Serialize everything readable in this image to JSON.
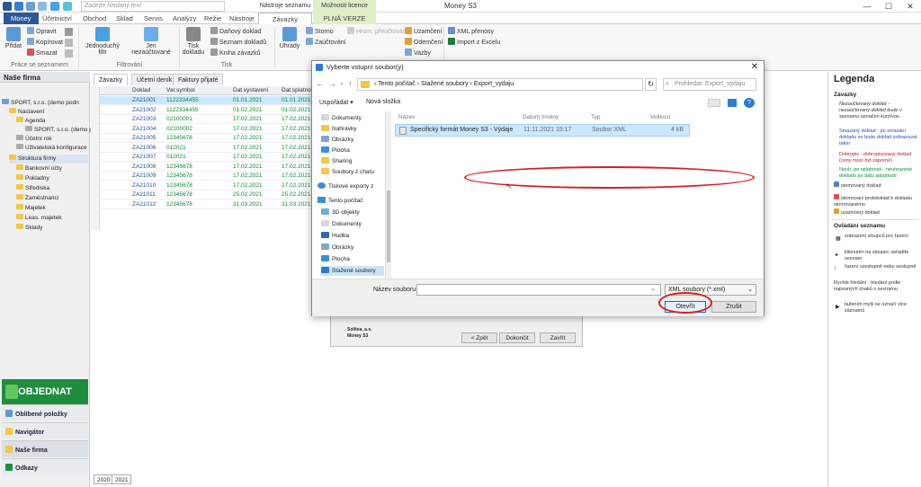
{
  "titlebar": {
    "search_placeholder": "Zadejte hledaný text",
    "context_tools": "Nástroje seznamu",
    "context_license": "Možnosti licence",
    "app_title": "Money S3",
    "min": "—",
    "max": "☐",
    "close": "✕"
  },
  "menubar": {
    "tabs": [
      "Money",
      "Účetnictví",
      "Obchod",
      "Sklad",
      "Servis",
      "Analýzy",
      "Režie",
      "Nástroje",
      "Závazky",
      "PLNÁ VERZE"
    ]
  },
  "ribbon": {
    "pridat": "Přidat",
    "opravit": "Opravit",
    "kopirovat": "Kopírovat",
    "smazat": "Smazat",
    "group_prace": "Práce se seznamem",
    "filtr": "Jednoduchý filtr",
    "jen_nezauct": "Jen nezaúčtované",
    "group_filtrovani": "Filtrování",
    "tisk_dokladu": "Tisk dokladu",
    "danovy_doklad": "Daňový doklad",
    "seznam_dokladu": "Seznam dokladů",
    "kniha_zavazku": "Kniha závazků",
    "group_tisk": "Tisk",
    "uhrady": "Úhrady",
    "storno": "Storno",
    "zauctovani": "Zaúčtování",
    "hrom_preuctovani": "Hrom. přeúčtování",
    "uzamceni": "Uzamčení",
    "odemceni": "Odemčení",
    "vazby": "Vazby",
    "xml_prenosy": "XML přenosy",
    "import_excel": "Import z Excelu"
  },
  "leftpanel": {
    "title": "Naše firma",
    "tree": [
      "SPORT, s.r.o. (demo podn",
      "Nastavení",
      "Agenda",
      "SPORT, s.r.o. (demo p",
      "Účetní rok",
      "Uživatelská konfigurace",
      "Struktura firmy",
      "Bankovní účty",
      "Pokladny",
      "Střediska",
      "Zaměstnanci",
      "Majetek",
      "Leas. majetek",
      "Sklady"
    ],
    "objednat": "OBJEDNAT",
    "oblibene": "Oblíbené položky",
    "navigator": "Navigátor",
    "nase_firma": "Naše firma",
    "odkazy": "Odkazy"
  },
  "main": {
    "tabs": [
      "Závazky",
      "Účetní deník",
      "Faktury přijaté"
    ],
    "columns": [
      "Doklad",
      "Var.symbol",
      "Dat.vystavení",
      "Dat.splatnost"
    ],
    "rows": [
      [
        "ZA21001",
        "1122334455",
        "01.01.2021",
        "01.01.2021"
      ],
      [
        "ZA21002",
        "1122334455",
        "01.02.2021",
        "01.02.2021"
      ],
      [
        "ZA21003",
        "02100001",
        "17.02.2021",
        "17.02.2021"
      ],
      [
        "ZA21004",
        "02100002",
        "17.02.2021",
        "17.02.2021"
      ],
      [
        "ZA21005",
        "12345678",
        "17.02.2021",
        "17.02.2021"
      ],
      [
        "ZA21006",
        "012021",
        "17.02.2021",
        "17.02.2021"
      ],
      [
        "ZA21007",
        "012021",
        "17.02.2021",
        "17.02.2021"
      ],
      [
        "ZA21008",
        "12345678",
        "17.02.2021",
        "17.02.2021"
      ],
      [
        "ZA21009",
        "12345678",
        "17.02.2021",
        "17.02.2021"
      ],
      [
        "ZA21010",
        "12345678",
        "17.02.2021",
        "17.02.2021"
      ],
      [
        "ZA21011",
        "12345678",
        "25.02.2021",
        "25.02.2021"
      ],
      [
        "ZA21012",
        "12345678",
        "31.03.2021",
        "31.03.2021"
      ]
    ],
    "year_tabs": [
      "2020",
      "2021"
    ]
  },
  "wizard": {
    "company": "Solitea, a.s.",
    "product": "Money S3",
    "back": "< Zpět",
    "next": "Dokončit",
    "close": "Zavřít"
  },
  "dialog": {
    "title": "Vyberte vstupní soubor(y)",
    "close": "✕",
    "path": [
      "Tento počítač",
      "Stažené soubory",
      "Export_vydaju"
    ],
    "search_placeholder": "Prohledat: Export_vydaju",
    "organize": "Uspořádat ▾",
    "new_folder": "Nová složka",
    "nav": [
      "Dokumenty",
      "Nahrávky",
      "Obrázky",
      "Plocha",
      "Sharing",
      "Soubory z chatu",
      "Tiskové exporty z",
      "Tento počítač",
      "3D objekty",
      "Dokumenty",
      "Hudba",
      "Obrázky",
      "Plocha",
      "Stažené soubory"
    ],
    "columns": [
      "Název",
      "Datum změny",
      "Typ",
      "Velikost"
    ],
    "file": {
      "name": "Specifický formát Money S3 - Výdaje",
      "date": "11.11.2021 15:17",
      "type": "Soubor XML",
      "size": "4 kB"
    },
    "filename_label": "Název souboru:",
    "filename_value": "",
    "filetype": "XML soubory (*.xml)",
    "open": "Otevřít",
    "cancel": "Zrušit"
  },
  "legend": {
    "title": "Legenda",
    "section1": "Závazky",
    "items1": [
      "Nezaúčtovaný doklad - nezaúčtovaný doklad bude v seznamu označen kurzívou",
      "Smazaný doklad - po smazání dokladu se bude doklad zobrazovat takto",
      "Dobropis - dobropisovaný doklad (ceny musí být záporné)",
      "Neuh. po splatnosti - neuhrazené doklady po datu splatnosti",
      "stornovaný doklad",
      "stornovací protidoklad k dokladu stornovanému",
      "uzamčený doklad"
    ],
    "section2": "Ovládání seznamu",
    "items2": [
      "zobrazení sloupců pro řazení",
      "kliknutím na sloupec seřadíte seznam",
      "řazení vzestupně nebo sestupně",
      "Rychlé hledání - hledání podle napsaných znaků v seznamu",
      "tažením myši se označí více záznamů"
    ],
    "colors": {
      "deleted": "#1f4eb4",
      "credit": "#c8102e",
      "overdue": "#0a8a3a"
    }
  },
  "colors": {
    "accent": "#2b5797",
    "objednat": "#1e8e3e",
    "annotation": "#d42020",
    "selection": "#cce8ff"
  }
}
